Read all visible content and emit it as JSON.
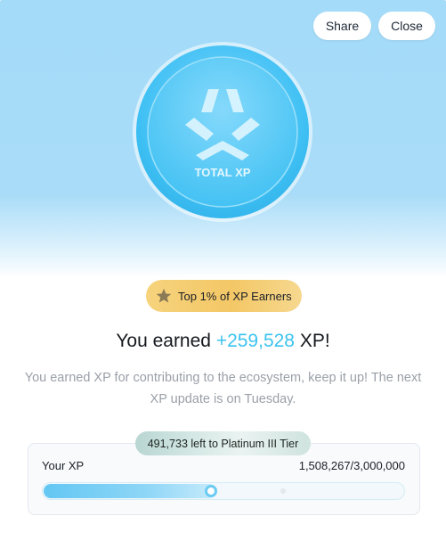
{
  "header": {
    "share_label": "Share",
    "close_label": "Close"
  },
  "coin": {
    "label": "TOTAL XP",
    "icon": "xp-logo-icon"
  },
  "badge": {
    "icon": "star-icon",
    "label": "Top 1% of XP Earners"
  },
  "headline": {
    "prefix": "You earned ",
    "amount": "+259,528",
    "suffix": " XP!"
  },
  "description": "You earned XP for contributing to the ecosystem, keep it up! The next XP update is on Tuesday.",
  "progress": {
    "tier_message": "491,733 left to Platinum III Tier",
    "label": "Your XP",
    "value_text": "1,508,267/3,000,000",
    "current": 1508267,
    "total": 3000000,
    "fill_fraction": 0.48
  },
  "colors": {
    "accent": "#3cc3ef",
    "badge_gold": "#f3c766",
    "hero_bg": "#a9dcf8"
  }
}
